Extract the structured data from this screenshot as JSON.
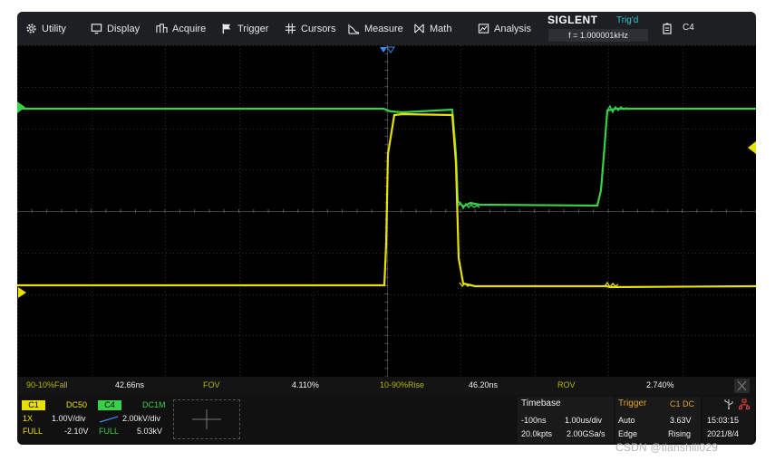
{
  "menu": {
    "items": [
      {
        "label": "Utility",
        "icon": "gear-icon"
      },
      {
        "label": "Display",
        "icon": "monitor-icon"
      },
      {
        "label": "Acquire",
        "icon": "acquire-icon"
      },
      {
        "label": "Trigger",
        "icon": "flag-icon"
      },
      {
        "label": "Cursors",
        "icon": "cursors-icon"
      },
      {
        "label": "Measure",
        "icon": "measure-icon"
      },
      {
        "label": "Math",
        "icon": "math-icon"
      },
      {
        "label": "Analysis",
        "icon": "analysis-icon"
      }
    ],
    "brand": "SIGLENT",
    "trig_status": "Trig'd",
    "frequency": "f = 1.000001kHz",
    "channel": "C4"
  },
  "colors": {
    "ch1": "#e8e000",
    "ch4": "#37d24a",
    "grid": "#3c3c3c",
    "background": "#000000"
  },
  "traces": {
    "ch4": [
      [
        0,
        70
      ],
      [
        404,
        70
      ],
      [
        412,
        73
      ],
      [
        425,
        74
      ],
      [
        480,
        71
      ],
      [
        484,
        120
      ],
      [
        486,
        172
      ],
      [
        492,
        178
      ],
      [
        500,
        174
      ],
      [
        510,
        176
      ],
      [
        640,
        177
      ],
      [
        644,
        160
      ],
      [
        647,
        124
      ],
      [
        651,
        72
      ],
      [
        660,
        70
      ],
      [
        815,
        70
      ]
    ],
    "ch1": [
      [
        0,
        265
      ],
      [
        405,
        265
      ],
      [
        407,
        220
      ],
      [
        409,
        120
      ],
      [
        416,
        77
      ],
      [
        425,
        76
      ],
      [
        480,
        77
      ],
      [
        484,
        130
      ],
      [
        487,
        235
      ],
      [
        492,
        263
      ],
      [
        505,
        266
      ],
      [
        650,
        266
      ],
      [
        654,
        267
      ],
      [
        815,
        266
      ]
    ]
  },
  "measurements": [
    {
      "name": "90-10%Fall",
      "value": "42.66ns"
    },
    {
      "name": "FOV",
      "value": "4.110%"
    },
    {
      "name": "10-90%Rise",
      "value": "46.20ns"
    },
    {
      "name": "ROV",
      "value": "2.740%"
    }
  ],
  "channels": {
    "c1": {
      "tag": "C1",
      "coupling": "DC50",
      "probe": "1X",
      "scale": "1.00V/div",
      "bw": "FULL",
      "offset": "-2.10V"
    },
    "c4": {
      "tag": "C4",
      "coupling": "DC1M",
      "scale": "2.00kV/div",
      "bw": "FULL",
      "offset": "5.03kV"
    }
  },
  "timebase": {
    "title": "Timebase",
    "delay": "-100ns",
    "scale": "1.00us/div",
    "points": "20.0kpts",
    "rate": "2.00GSa/s"
  },
  "trigger": {
    "title": "Trigger",
    "source": "C1 DC",
    "mode": "Auto",
    "level": "3.63V",
    "type": "Edge",
    "slope": "Rising"
  },
  "clock": {
    "time": "15:03:15",
    "date": "2021/8/4"
  },
  "watermark": "CSDN @tianshili029"
}
